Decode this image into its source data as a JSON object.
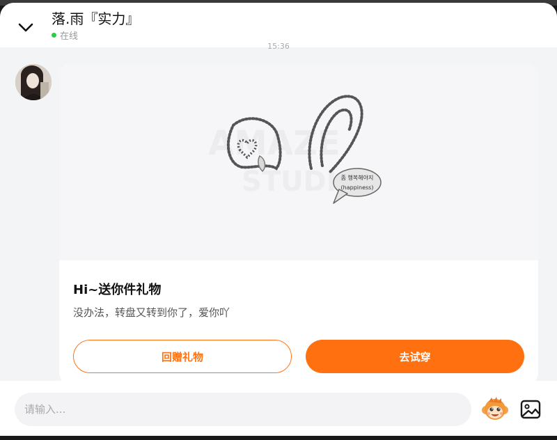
{
  "header": {
    "title": "落.雨『实力』",
    "status_text": "在线",
    "status_color": "#2ecc40",
    "collapse_icon": "chevron-down-icon"
  },
  "message": {
    "timestamp": "15:36",
    "card": {
      "image_caption_korean": "좀 행복해야지",
      "image_caption_english": "(happiness)",
      "title": "Hi~送你件礼物",
      "description": "没办法，转盘又转到你了，爱你吖",
      "secondary_button": "回赠礼物",
      "primary_button": "去试穿"
    }
  },
  "input_bar": {
    "placeholder": "请输入...",
    "emoji_icon": "monkey-emoji-icon",
    "image_icon": "image-icon"
  },
  "colors": {
    "accent": "#ff7010",
    "online": "#2ecc40"
  }
}
